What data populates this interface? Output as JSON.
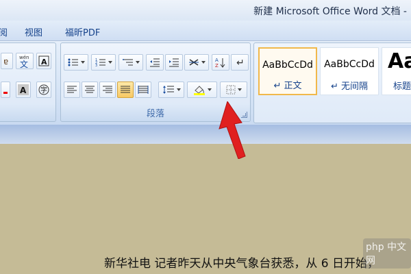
{
  "window": {
    "title": "新建 Microsoft Office Word 文档 -"
  },
  "menu": {
    "items": [
      "阅",
      "视图",
      "福昕PDF"
    ]
  },
  "ribbon": {
    "paragraph_group_label": "段落",
    "styles": [
      {
        "sample": "AaBbCcDd",
        "name": "正文",
        "selected": true
      },
      {
        "sample": "AaBbCcDd",
        "name": "无间隔",
        "selected": false
      },
      {
        "sample": "Aa",
        "name": "标题"
      }
    ]
  },
  "document": {
    "body_text": "新华社电  记者昨天从中央气象台获悉，从 6 日开始，"
  },
  "watermark": {
    "text": "php 中文网"
  },
  "colors": {
    "highlight": "#f8c964",
    "arrow": "#e02020",
    "accent_blue": "#15428b"
  }
}
